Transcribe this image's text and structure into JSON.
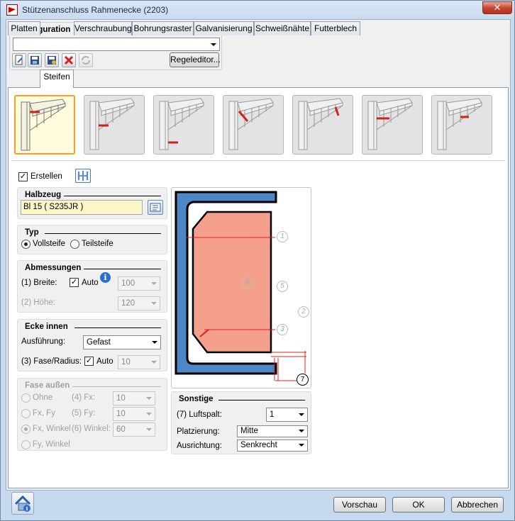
{
  "window": {
    "title": "Stützenanschluss Rahmenecke (2203)",
    "close_glyph": "✕"
  },
  "konfiguration": {
    "title": "Konfiguration",
    "value": "",
    "regeleditor_label": "Regeleditor...",
    "tool_icons": [
      "new-icon",
      "save-icon",
      "save-as-icon",
      "delete-icon",
      "refresh-icon"
    ]
  },
  "tabs": [
    {
      "label": "Platten"
    },
    {
      "label": "Steifen",
      "active": true
    },
    {
      "label": "Verschraubung"
    },
    {
      "label": "Bohrungsraster"
    },
    {
      "label": "Galvanisierung"
    },
    {
      "label": "Schweißnähte"
    },
    {
      "label": "Futterblech"
    }
  ],
  "variants": {
    "count": 7,
    "selected_index": 0
  },
  "erstellen": {
    "label": "Erstellen",
    "checked": true
  },
  "halbzeug": {
    "title": "Halbzeug",
    "value": "Bl 15  ( S235JR )"
  },
  "typ": {
    "title": "Typ",
    "option1": "Vollsteife",
    "option2": "Teilsteife",
    "selected": "Vollsteife"
  },
  "abmessungen": {
    "title": "Abmessungen",
    "breite_label": "(1) Breite:",
    "auto_label": "Auto",
    "breite_value": "100",
    "hoehe_label": "(2) Höhe:",
    "hoehe_value": "120"
  },
  "ecke_innen": {
    "title": "Ecke innen",
    "ausfuehrung_label": "Ausführung:",
    "ausfuehrung_value": "Gefast",
    "fase_label": "(3) Fase/Radius:",
    "auto_label": "Auto",
    "fase_value": "10"
  },
  "fase_aussen": {
    "title": "Fase außen",
    "ohne": "Ohne",
    "fx_fy": "Fx, Fy",
    "fx_winkel": "Fx, Winkel",
    "fy_winkel": "Fy, Winkel",
    "fx_label": "(4) Fx:",
    "fx_value": "10",
    "fy_label": "(5) Fy:",
    "fy_value": "10",
    "winkel_label": "(6) Winkel:",
    "winkel_value": "60"
  },
  "diagram": {
    "labels": [
      "1",
      "2",
      "3",
      "5",
      "6",
      "7"
    ]
  },
  "sonstige": {
    "title": "Sonstige",
    "luftspalt_label": "(7) Luftspalt:",
    "luftspalt_value": "1",
    "platzierung_label": "Platzierung:",
    "platzierung_value": "Mitte",
    "ausrichtung_label": "Ausrichtung:",
    "ausrichtung_value": "Senkrecht"
  },
  "footer": {
    "vorschau": "Vorschau",
    "ok": "OK",
    "abbrechen": "Abbrechen"
  },
  "colors": {
    "accent": "#f0a030",
    "stiffener": "#f4a08c",
    "profile": "#4f86c6",
    "dimension": "#e02020"
  }
}
